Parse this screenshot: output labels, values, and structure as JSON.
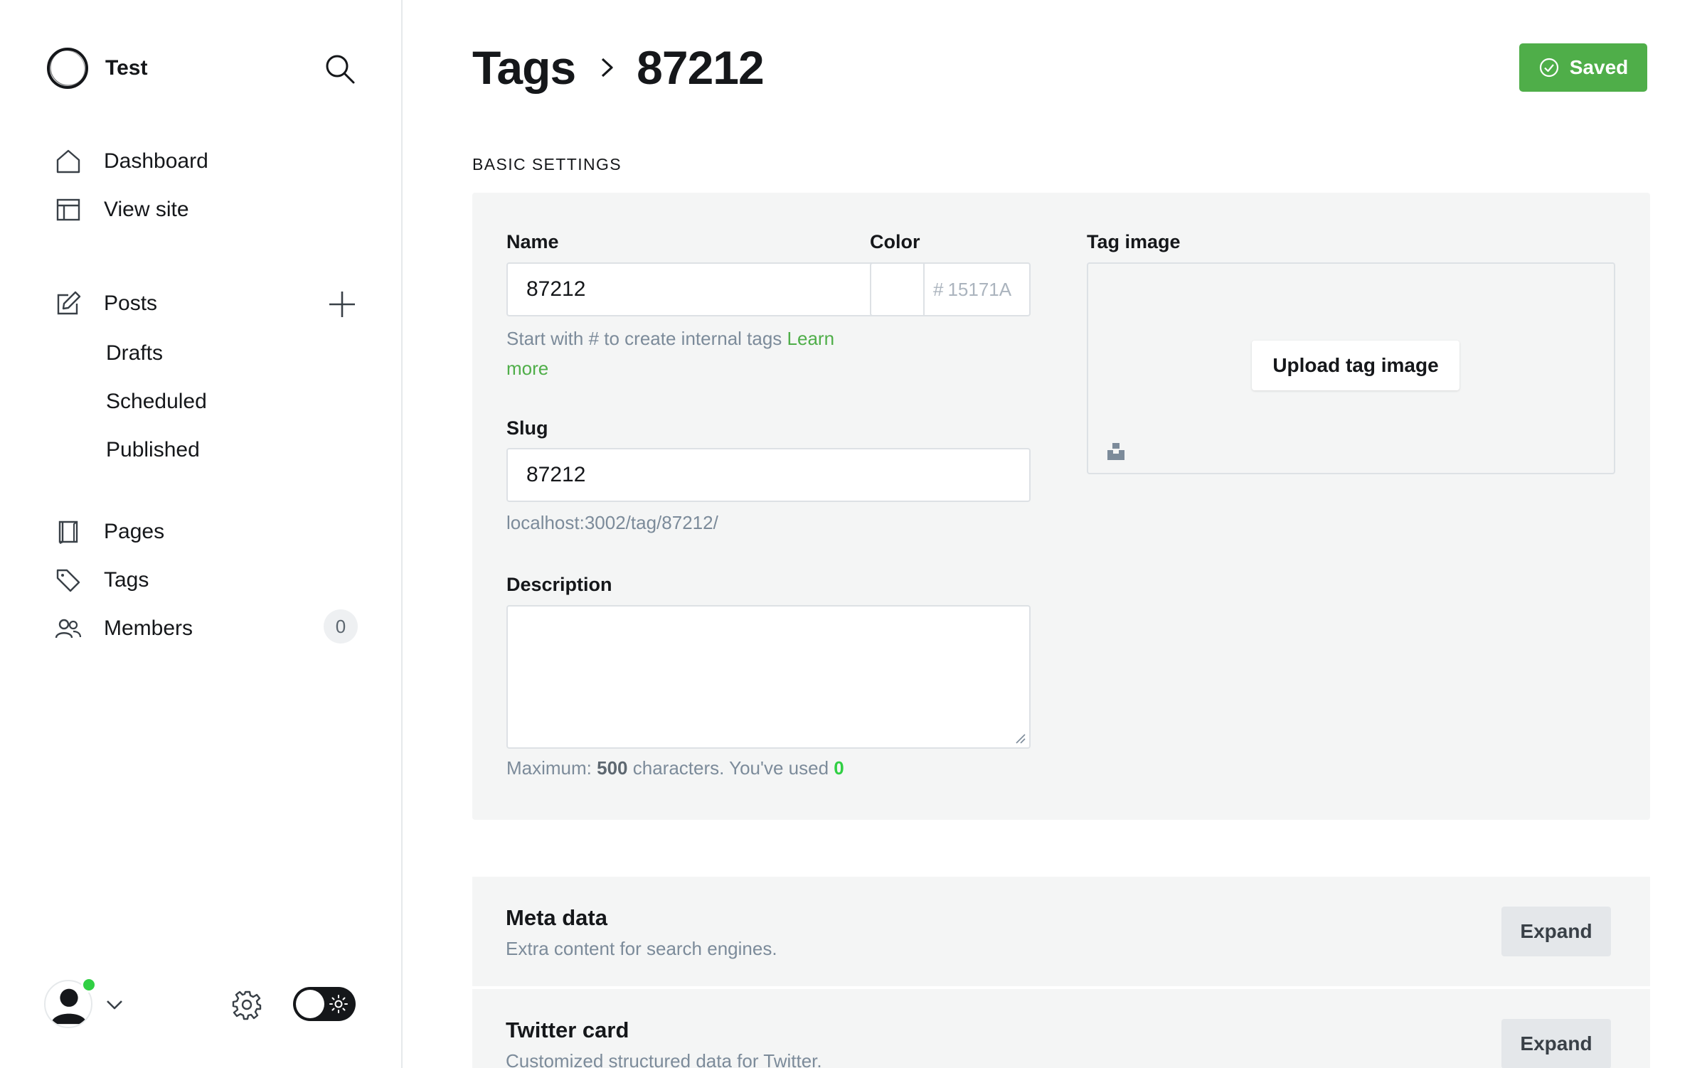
{
  "brand": {
    "name": "Test"
  },
  "sidebar": {
    "nav_top": [
      {
        "label": "Dashboard",
        "icon": "home-icon"
      },
      {
        "label": "View site",
        "icon": "layout-icon"
      }
    ],
    "posts": {
      "label": "Posts",
      "icon": "pencil-icon",
      "sub_items": [
        "Drafts",
        "Scheduled",
        "Published"
      ]
    },
    "nav_bottom": [
      {
        "label": "Pages",
        "icon": "page-icon"
      },
      {
        "label": "Tags",
        "icon": "tag-icon"
      },
      {
        "label": "Members",
        "icon": "members-icon",
        "count": "0"
      }
    ]
  },
  "header": {
    "parent": "Tags",
    "current": "87212",
    "saved_label": "Saved"
  },
  "section": {
    "title": "BASIC SETTINGS"
  },
  "form": {
    "name": {
      "label": "Name",
      "value": "87212",
      "hint_prefix": "Start with # to create internal tags",
      "hint_link_1": "Learn",
      "hint_link_2": "more"
    },
    "color": {
      "label": "Color",
      "hash": "#",
      "placeholder": "15171A",
      "swatch": "#ffffff"
    },
    "slug": {
      "label": "Slug",
      "value": "87212",
      "url": "localhost:3002/tag/87212/"
    },
    "description": {
      "label": "Description",
      "value": "",
      "hint_max_prefix": "Maximum:",
      "hint_max": "500",
      "hint_middle": "characters. You've used",
      "hint_used": "0"
    },
    "tag_image": {
      "label": "Tag image",
      "upload_label": "Upload tag image"
    }
  },
  "expandables": [
    {
      "title": "Meta data",
      "description": "Extra content for search engines.",
      "button": "Expand"
    },
    {
      "title": "Twitter card",
      "description": "Customized structured data for Twitter.",
      "button": "Expand"
    }
  ],
  "colors": {
    "accent": "#4fae49",
    "online": "#30cf43",
    "text": "#15171a",
    "muted": "#7c8b9a",
    "panel": "#f4f5f5"
  }
}
